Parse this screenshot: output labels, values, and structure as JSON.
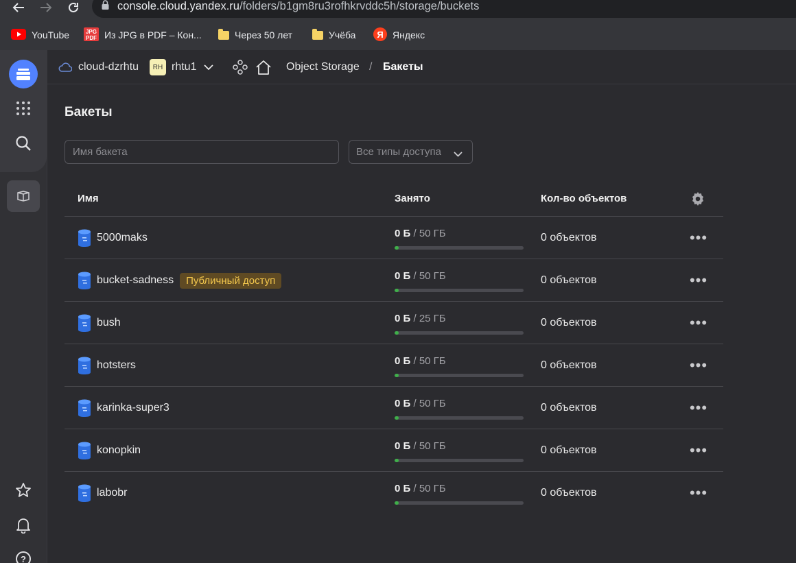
{
  "browser": {
    "url_host": "console.cloud.yandex.ru",
    "url_path": "/folders/b1gm8ru3rofhkrvddc5h/storage/buckets",
    "bookmarks": [
      {
        "label": "YouTube",
        "icon": "youtube-icon"
      },
      {
        "label": "Из JPG в PDF – Кон...",
        "icon": "jpg-pdf-icon"
      },
      {
        "label": "Через 50 лет",
        "icon": "folder-icon"
      },
      {
        "label": "Учёба",
        "icon": "folder-icon"
      },
      {
        "label": "Яндекс",
        "icon": "yandex-icon"
      }
    ]
  },
  "header": {
    "cloud": "cloud-dzrhtu",
    "folder_badge": "RH",
    "folder": "rhtu1",
    "breadcrumb_service": "Object Storage",
    "breadcrumb_separator": "/",
    "breadcrumb_current": "Бакеты"
  },
  "main": {
    "title": "Бакеты",
    "search_placeholder": "Имя бакета",
    "access_filter": "Все типы доступа"
  },
  "table": {
    "columns": {
      "name": "Имя",
      "used": "Занято",
      "objects": "Кол-во объектов"
    },
    "rows": [
      {
        "name": "5000maks",
        "badge": "",
        "used": "0 Б",
        "limit": "50 ГБ",
        "fill": 0.0,
        "objects": "0 объектов"
      },
      {
        "name": "bucket-sadness",
        "badge": "Публичный доступ",
        "used": "0 Б",
        "limit": "50 ГБ",
        "fill": 0.0,
        "objects": "0 объектов"
      },
      {
        "name": "bush",
        "badge": "",
        "used": "0 Б",
        "limit": "25 ГБ",
        "fill": 0.0,
        "objects": "0 объектов"
      },
      {
        "name": "hotsters",
        "badge": "",
        "used": "0 Б",
        "limit": "50 ГБ",
        "fill": 0.0,
        "objects": "0 объектов"
      },
      {
        "name": "karinka-super3",
        "badge": "",
        "used": "0 Б",
        "limit": "50 ГБ",
        "fill": 0.0,
        "objects": "0 объектов"
      },
      {
        "name": "konopkin",
        "badge": "",
        "used": "0 Б",
        "limit": "50 ГБ",
        "fill": 0.0,
        "objects": "0 объектов"
      },
      {
        "name": "labobr",
        "badge": "",
        "used": "0 Б",
        "limit": "50 ГБ",
        "fill": 0.0,
        "objects": "0 объектов"
      }
    ]
  },
  "colors": {
    "accent": "#5282ff",
    "badge_bg": "#5f4a23",
    "badge_text": "#f3c74d",
    "usage_bar": "#3fb04a"
  }
}
